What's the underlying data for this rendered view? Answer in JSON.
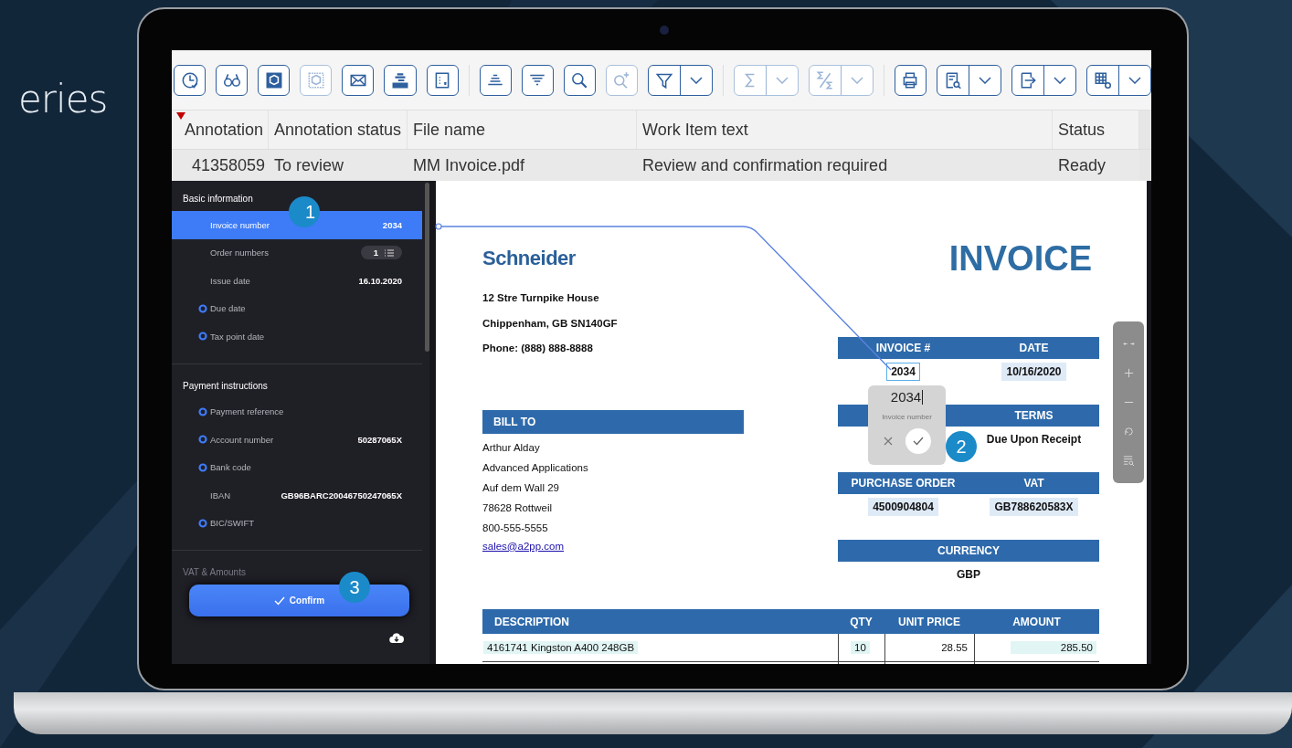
{
  "slide_title": "eries",
  "toolbar": {
    "groups": [
      {
        "buttons": [
          {
            "kind": "button",
            "disabled": false
          },
          {
            "kind": "button",
            "disabled": false
          },
          {
            "kind": "button",
            "disabled": false
          },
          {
            "kind": "button",
            "disabled": true
          },
          {
            "kind": "button",
            "disabled": false
          },
          {
            "kind": "button",
            "disabled": false
          },
          {
            "kind": "button",
            "disabled": false
          }
        ]
      },
      {
        "buttons": [
          {
            "kind": "button",
            "disabled": false
          },
          {
            "kind": "button",
            "disabled": false
          },
          {
            "kind": "button",
            "disabled": false
          },
          {
            "kind": "button",
            "disabled": true
          },
          {
            "kind": "split",
            "disabled": false
          }
        ]
      },
      {
        "buttons": [
          {
            "kind": "split",
            "disabled": true
          },
          {
            "kind": "split",
            "disabled": true
          }
        ]
      },
      {
        "buttons": [
          {
            "kind": "button",
            "disabled": false
          },
          {
            "kind": "split",
            "disabled": false
          },
          {
            "kind": "split",
            "disabled": false
          },
          {
            "kind": "split",
            "disabled": false
          }
        ]
      }
    ]
  },
  "table": {
    "columns": [
      {
        "label": "Annotation",
        "sorted": true
      },
      {
        "label": "Annotation status",
        "sorted": false
      },
      {
        "label": "File name",
        "sorted": false
      },
      {
        "label": "Work Item text",
        "sorted": false
      },
      {
        "label": "Status",
        "sorted": false
      }
    ],
    "rows": [
      {
        "selected": true,
        "cells": [
          "41358059",
          "To review",
          "MM Invoice.pdf",
          "Review and confirmation required",
          "Ready"
        ]
      }
    ]
  },
  "sidebar": {
    "sections": [
      {
        "title": "Basic information",
        "fields": [
          {
            "label": "Invoice number",
            "value": "2034",
            "kind": "text",
            "selected": true,
            "missing": false
          },
          {
            "label": "Order numbers",
            "value": "1",
            "kind": "list",
            "selected": false,
            "missing": false
          },
          {
            "label": "Issue date",
            "value": "16.10.2020",
            "kind": "text",
            "selected": false,
            "missing": false
          },
          {
            "label": "Due date",
            "selected": false,
            "missing": true
          },
          {
            "label": "Tax point date",
            "selected": false,
            "missing": true
          }
        ]
      },
      {
        "title": "Payment instructions",
        "fields": [
          {
            "label": "Payment reference",
            "selected": false,
            "missing": true
          },
          {
            "label": "Account number",
            "value": "50287065X",
            "kind": "text",
            "selected": false,
            "missing": true
          },
          {
            "label": "Bank code",
            "selected": false,
            "missing": true
          },
          {
            "label": "IBAN",
            "value": "GB96BARC20046750247065X",
            "kind": "text",
            "selected": false,
            "missing": false
          },
          {
            "label": "BIC/SWIFT",
            "selected": false,
            "missing": true
          }
        ]
      },
      {
        "title": "VAT & Amounts"
      }
    ]
  },
  "confirm_button": {
    "label": "Confirm"
  },
  "callouts": [
    "1",
    "2",
    "3"
  ],
  "document": {
    "company": "Schneider",
    "title": "INVOICE",
    "address": [
      "12 Stre Turnpike House",
      "Chippenham, GB SN140GF",
      "Phone: (888) 888-8888"
    ],
    "bill_to": {
      "heading": "BILL TO",
      "lines": [
        "Arthur Alday",
        "Advanced Applications",
        "Auf dem Wall 29",
        "78628 Rottweil",
        "800-555-5555"
      ],
      "email": "sales@a2pp.com"
    },
    "meta": [
      {
        "cells": [
          {
            "heading": "INVOICE #",
            "value": "2034",
            "selected": true,
            "detected": false
          },
          {
            "heading": "DATE",
            "value": "10/16/2020",
            "selected": false,
            "detected": true
          }
        ]
      },
      {
        "cells": [
          null,
          {
            "heading": "TERMS",
            "value": "Due Upon Receipt",
            "selected": false,
            "detected": false
          }
        ]
      },
      {
        "cells": [
          {
            "heading": "PURCHASE ORDER",
            "value": "4500904804",
            "selected": false,
            "detected": true
          },
          {
            "heading": "VAT",
            "value": "GB788620583X",
            "selected": false,
            "detected": true
          }
        ]
      },
      {
        "cells": [
          {
            "heading": "CURRENCY",
            "value": "GBP",
            "selected": false,
            "detected": false
          }
        ]
      }
    ],
    "items": {
      "columns": [
        "DESCRIPTION",
        "QTY",
        "UNIT PRICE",
        "AMOUNT"
      ],
      "rows": [
        {
          "cells": [
            {
              "text": "4161741 Kingston A400 248GB",
              "detected": true
            },
            {
              "text": "10",
              "detected": true
            },
            {
              "text": "28.55",
              "detected": false
            },
            {
              "text": "285.50",
              "detected": true
            }
          ]
        }
      ]
    }
  },
  "popup": {
    "value": "2034",
    "label": "Invoice number"
  }
}
